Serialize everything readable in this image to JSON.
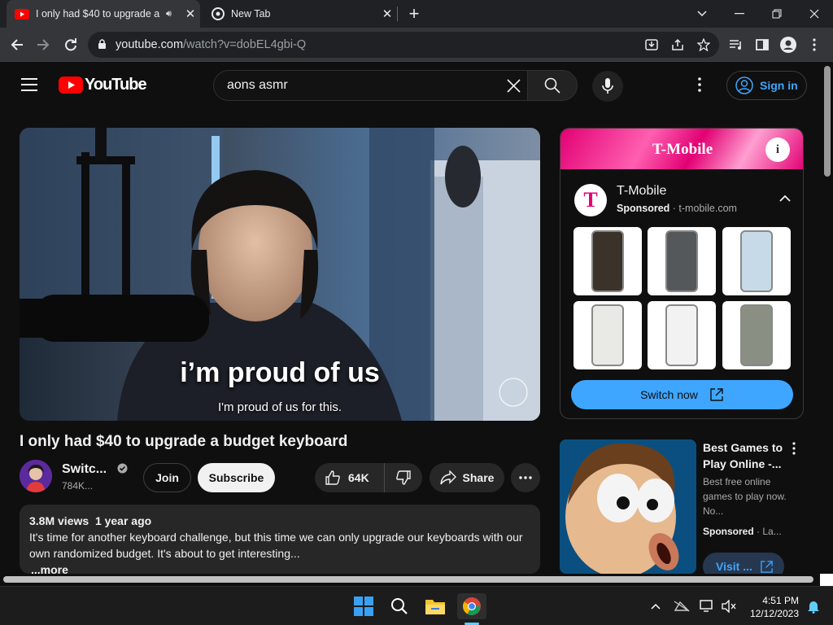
{
  "browser": {
    "tabs": [
      {
        "title": "I only had $40 to upgrade a",
        "active": true,
        "audio": true
      },
      {
        "title": "New Tab",
        "active": false
      }
    ],
    "url_host": "youtube.com",
    "url_path": "/watch?v=dobEL4gbi-Q"
  },
  "youtube": {
    "logo_text": "YouTube",
    "search_query": "aons asmr",
    "sign_in": "Sign in"
  },
  "video": {
    "caption_big": "i’m proud of us",
    "caption_sub": "I'm proud of us for this.",
    "title": "I only had $40 to upgrade a budget keyboard",
    "channel": "Switc...",
    "subscribers": "784K...",
    "join": "Join",
    "subscribe": "Subscribe",
    "likes": "64K",
    "share": "Share",
    "views": "3.8M views",
    "age": "1 year ago",
    "description": "It's time for another keyboard challenge, but this time we can only upgrade our keyboards with our own randomized budget. It's about to get interesting...",
    "more": "...more"
  },
  "ad": {
    "banner": "T-Mobile",
    "name": "T-Mobile",
    "sponsored": "Sponsored",
    "domain": "t-mobile.com",
    "cta": "Switch now"
  },
  "recommendation": {
    "title": "Best Games to Play Online -...",
    "desc": "Best free online games to play now. No...",
    "sponsored": "Sponsored",
    "advertiser": "La...",
    "cta": "Visit ..."
  },
  "taskbar": {
    "time": "4:51 PM",
    "date": "12/12/2023"
  },
  "colors": {
    "youtube_red": "#ff0000",
    "tmobile_magenta": "#e20074",
    "link_blue": "#3ea6ff"
  }
}
